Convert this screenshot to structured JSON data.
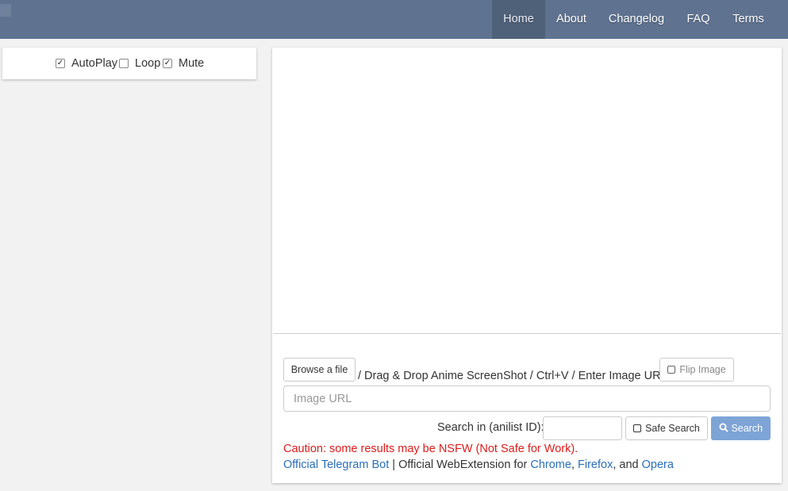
{
  "nav": {
    "items": [
      {
        "label": "Home",
        "active": true
      },
      {
        "label": "About"
      },
      {
        "label": "Changelog"
      },
      {
        "label": "FAQ"
      },
      {
        "label": "Terms"
      }
    ]
  },
  "player_options": {
    "autoplay": {
      "label": "AutoPlay",
      "checked": true
    },
    "loop": {
      "label": "Loop",
      "checked": false
    },
    "mute": {
      "label": "Mute",
      "checked": true
    }
  },
  "upload": {
    "browse_label": "Browse a file",
    "hint": "/ Drag & Drop Anime ScreenShot / Ctrl+V / Enter Image URL",
    "flip_label": "Flip Image",
    "url_placeholder": "Image URL"
  },
  "search": {
    "anilist_label": "Search in (anilist ID):",
    "anilist_value": "",
    "safe_search_label": "Safe Search",
    "safe_search_checked": false,
    "search_label": "Search"
  },
  "notice": {
    "caution": "Caution: some results may be NSFW (Not Safe for Work).",
    "telegram": "Official Telegram Bot",
    "separator": " | ",
    "webext_prefix": "Official WebExtension for ",
    "chrome": "Chrome",
    "comma": ", ",
    "firefox": "Firefox",
    "and": ", and ",
    "opera": "Opera"
  },
  "colors": {
    "navbar": "#5f7290",
    "active_nav": "#4f6079",
    "primary": "#7ea4d6",
    "link": "#2a6ebd",
    "warning": "#e01b1b"
  }
}
